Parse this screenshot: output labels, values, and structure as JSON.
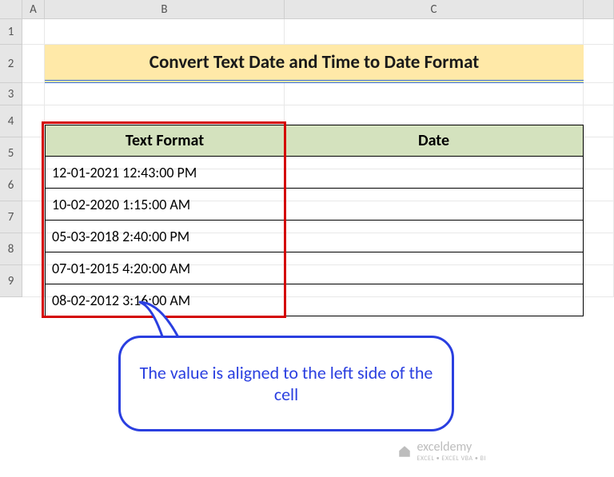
{
  "columns": {
    "A": "A",
    "B": "B",
    "C": "C"
  },
  "rows": [
    "1",
    "2",
    "3",
    "4",
    "5",
    "6",
    "7",
    "8",
    "9"
  ],
  "title": "Convert Text Date and Time to Date Format",
  "headers": {
    "B": "Text Format",
    "C": "Date"
  },
  "data": [
    {
      "text": "12-01-2021  12:43:00 PM",
      "date": ""
    },
    {
      "text": "10-02-2020  1:15:00 AM",
      "date": ""
    },
    {
      "text": "05-03-2018  2:40:00 PM",
      "date": ""
    },
    {
      "text": "07-01-2015  4:20:00 AM",
      "date": ""
    },
    {
      "text": "08-02-2012  3:16:00 AM",
      "date": ""
    }
  ],
  "callout": "The value is aligned to the left side of the cell",
  "watermark": {
    "brand": "exceldemy",
    "tagline": "EXCEL • EXCEL VBA • BI"
  }
}
